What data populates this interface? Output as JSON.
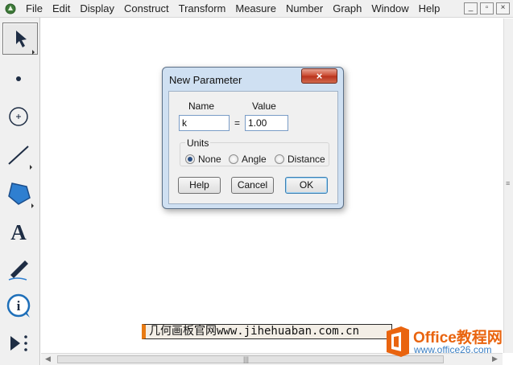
{
  "menubar": {
    "items": [
      "File",
      "Edit",
      "Display",
      "Construct",
      "Transform",
      "Measure",
      "Number",
      "Graph",
      "Window",
      "Help"
    ],
    "controls": [
      "_",
      "▫",
      "×"
    ]
  },
  "toolbox": {
    "tools": [
      "arrow-select",
      "point",
      "compass",
      "straightedge",
      "polygon",
      "text",
      "marker",
      "information",
      "custom-tools"
    ],
    "text_tool_glyph": "A"
  },
  "dialog": {
    "title": "New Parameter",
    "close": "×",
    "name_label": "Name",
    "value_label": "Value",
    "name_value": "k",
    "equals": "=",
    "value_value": "1.00",
    "units_label": "Units",
    "units_options": [
      {
        "label": "None",
        "selected": true
      },
      {
        "label": "Angle",
        "selected": false
      },
      {
        "label": "Distance",
        "selected": false
      }
    ],
    "help_label": "Help",
    "cancel_label": "Cancel",
    "ok_label": "OK"
  },
  "banner": {
    "text": "几何画板官网www.jihehuaban.com.cn"
  },
  "watermark": {
    "name": "Office教程网",
    "site": "www.office26.com",
    "accent": "#e9640f"
  },
  "scrollbar": {
    "grip": "|||",
    "vgrip": "≡"
  }
}
